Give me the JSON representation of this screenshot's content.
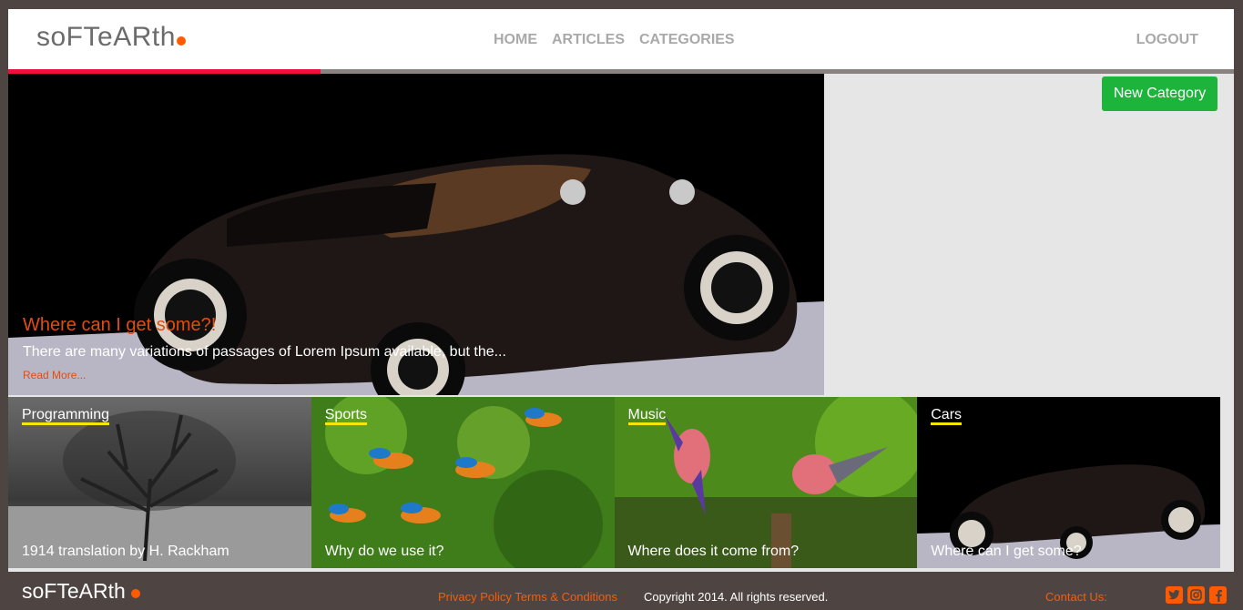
{
  "header": {
    "logo": "soFTeARth",
    "nav": [
      "HOME",
      "ARTICLES",
      "CATEGORIES"
    ],
    "logout": "LOGOUT"
  },
  "progress": {
    "value": 0.255,
    "color": "#ee0f3c"
  },
  "actions": {
    "new_category": "New Category"
  },
  "hero": {
    "title": "Where can I get some?!",
    "excerpt": "There are many variations of passages of Lorem Ipsum available, but the...",
    "read_more": "Read More..."
  },
  "cards": [
    {
      "category": "Programming",
      "title": "1914 translation by H. Rackham",
      "image": "bare-tree-photo"
    },
    {
      "category": "Sports",
      "title": "Why do we use it?",
      "image": "kingfishers-photo"
    },
    {
      "category": "Music",
      "title": "Where does it come from?",
      "image": "parrots-photo"
    },
    {
      "category": "Cars",
      "title": "Where can I get some?",
      "image": "vintage-car-photo"
    }
  ],
  "footer": {
    "logo": "soFTeARth",
    "privacy": "Privacy Policy",
    "terms": "Terms & Conditions",
    "copyright": "Copyright 2014. All rights reserved.",
    "contact": "Contact Us:",
    "social": [
      "twitter-icon",
      "instagram-icon",
      "facebook-icon"
    ]
  },
  "colors": {
    "accent": "#ff5a00",
    "success": "#1db43c",
    "underline": "#f5e60a",
    "progress": "#ee0f3c"
  }
}
